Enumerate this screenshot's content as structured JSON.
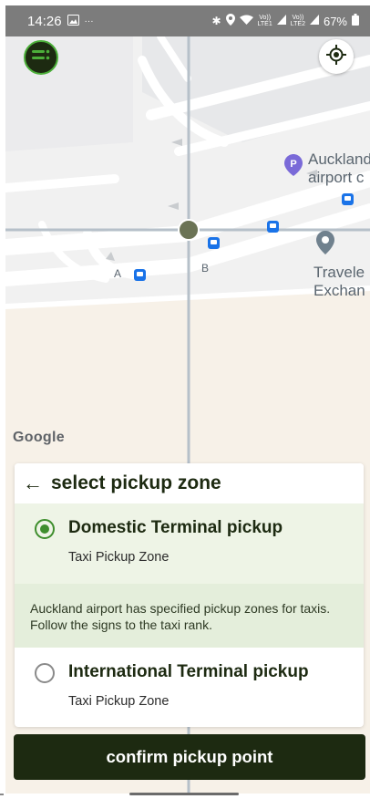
{
  "status_bar": {
    "time": "14:26",
    "battery": "67%",
    "carrier_1": "Vo))\nLTE1",
    "carrier_2": "Vo))\nLTE2"
  },
  "map": {
    "labels": {
      "auckland_airport": "Auckland\nairport c",
      "travelex": "Travele\nExchan",
      "gate_a": "A",
      "gate_b": "B"
    },
    "attribution": "Google"
  },
  "pickup_sheet": {
    "title": "select pickup zone",
    "options": [
      {
        "title": "Domestic Terminal pickup",
        "subtitle": "Taxi Pickup Zone",
        "selected": true
      },
      {
        "title": "International Terminal pickup",
        "subtitle": "Taxi Pickup Zone",
        "selected": false
      }
    ],
    "info_text": "Auckland airport has specified pickup zones for taxis. Follow the signs to the taxi rank."
  },
  "confirm_button": {
    "label": "confirm pickup point"
  },
  "colors": {
    "brand_dark": "#1d2a11",
    "accent_green": "#3e8e2d",
    "selected_bg": "#eef4e6",
    "info_bg": "#e4eedb",
    "map_pin_purple": "#7a6ad8",
    "bus_blue": "#1a73e8"
  },
  "icons": {
    "menu": "menu-icon",
    "locate": "my-location-icon",
    "back": "arrow-left-icon",
    "parking": "parking-pin-icon",
    "place": "place-pin-icon",
    "bus": "bus-stop-icon"
  }
}
